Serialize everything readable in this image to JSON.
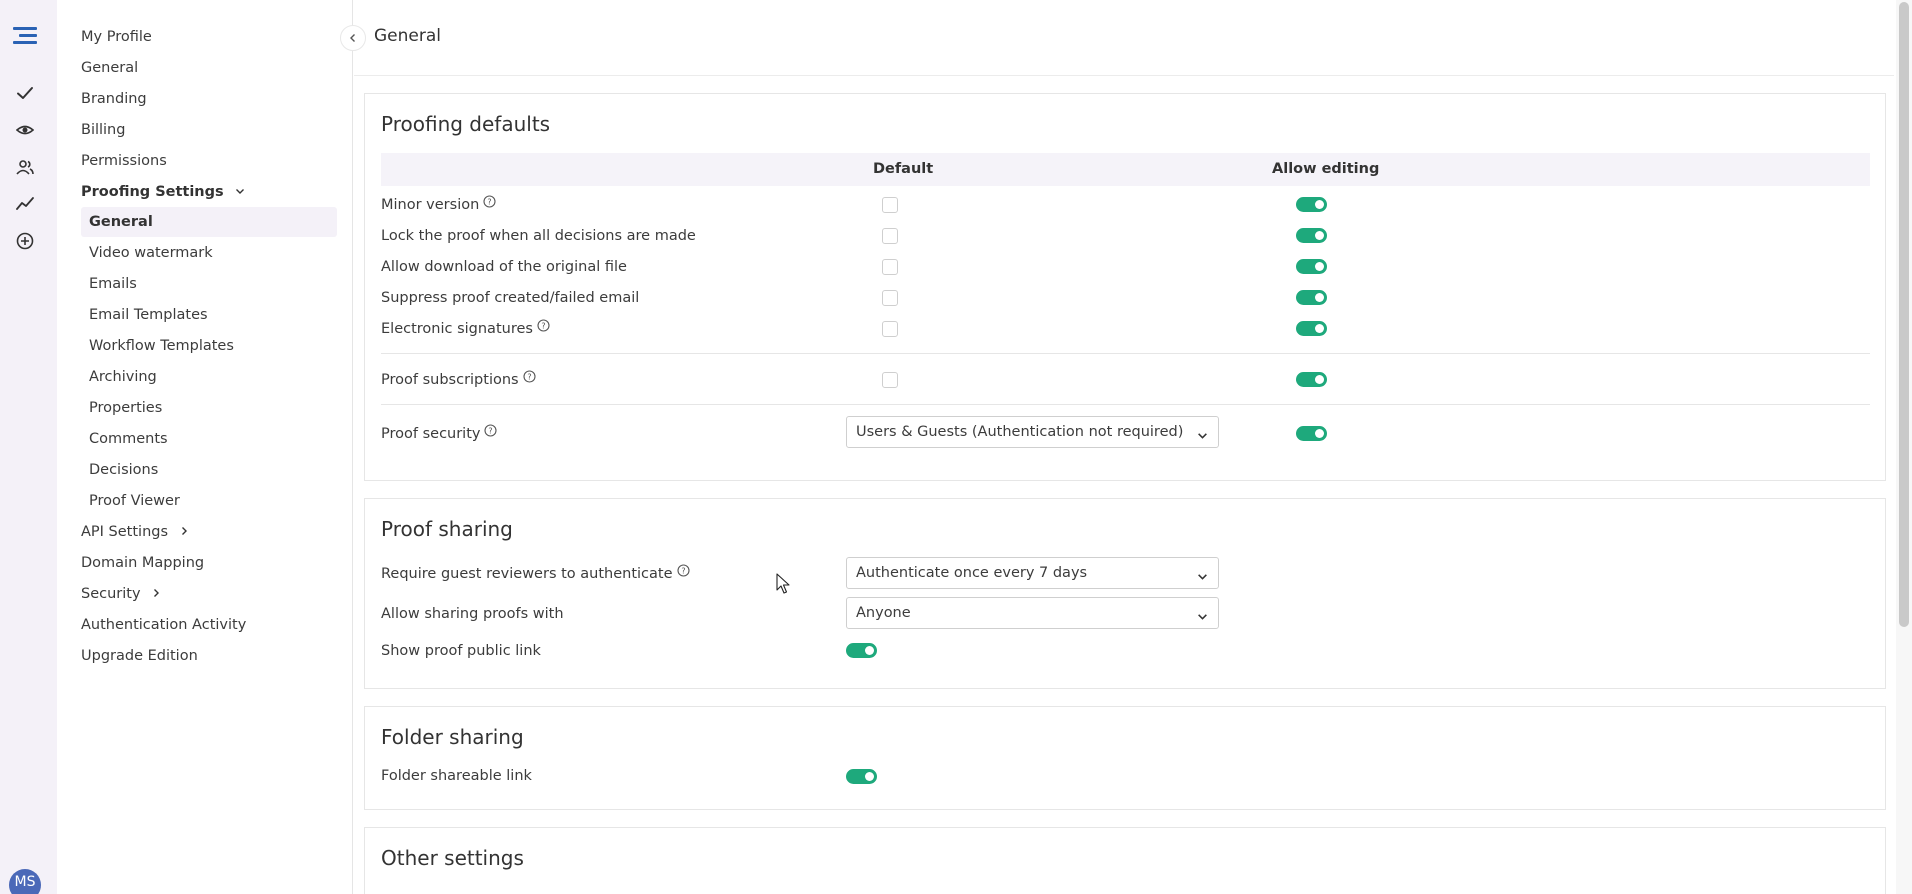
{
  "rail": {
    "icons": [
      "menu-icon",
      "check-icon",
      "eye-icon",
      "users-icon",
      "activity-icon",
      "plus-circle-icon"
    ],
    "avatar_initials": "MS",
    "avatar_color": "#4b69b8"
  },
  "sidebar": {
    "items": [
      {
        "label": "My Profile"
      },
      {
        "label": "General"
      },
      {
        "label": "Branding"
      },
      {
        "label": "Billing"
      },
      {
        "label": "Permissions"
      },
      {
        "label": "Proofing Settings"
      }
    ],
    "proofing_sub": [
      {
        "label": "General"
      },
      {
        "label": "Video watermark"
      },
      {
        "label": "Emails"
      },
      {
        "label": "Email Templates"
      },
      {
        "label": "Workflow Templates"
      },
      {
        "label": "Archiving"
      },
      {
        "label": "Properties"
      },
      {
        "label": "Comments"
      },
      {
        "label": "Decisions"
      },
      {
        "label": "Proof Viewer"
      }
    ],
    "bottom_items": [
      {
        "label": "API Settings"
      },
      {
        "label": "Domain Mapping"
      },
      {
        "label": "Security"
      },
      {
        "label": "Authentication Activity"
      },
      {
        "label": "Upgrade Edition"
      }
    ]
  },
  "header": {
    "title": "General"
  },
  "proofing_defaults": {
    "title": "Proofing defaults",
    "col_default": "Default",
    "col_allow_editing": "Allow editing",
    "rows": [
      {
        "label": "Minor version"
      },
      {
        "label": "Lock the proof when all decisions are made"
      },
      {
        "label": "Allow download of the original file"
      },
      {
        "label": "Suppress proof created/failed email"
      },
      {
        "label": "Electronic signatures"
      },
      {
        "label": "Proof subscriptions"
      },
      {
        "label": "Proof security"
      }
    ],
    "security_value": "Users & Guests (Authentication not required)"
  },
  "proof_sharing": {
    "title": "Proof sharing",
    "rows": [
      {
        "label": "Require guest reviewers to authenticate",
        "value": "Authenticate once every 7 days"
      },
      {
        "label": "Allow sharing proofs with",
        "value": "Anyone"
      },
      {
        "label": "Show proof public link"
      }
    ]
  },
  "folder_sharing": {
    "title": "Folder sharing",
    "rows": [
      {
        "label": "Folder shareable link"
      }
    ]
  },
  "other_settings": {
    "title": "Other settings"
  },
  "colors": {
    "accent_toggle": "#1ea97c",
    "brand_blue": "#2a62b4",
    "rail_bg": "#f4f1f8"
  }
}
